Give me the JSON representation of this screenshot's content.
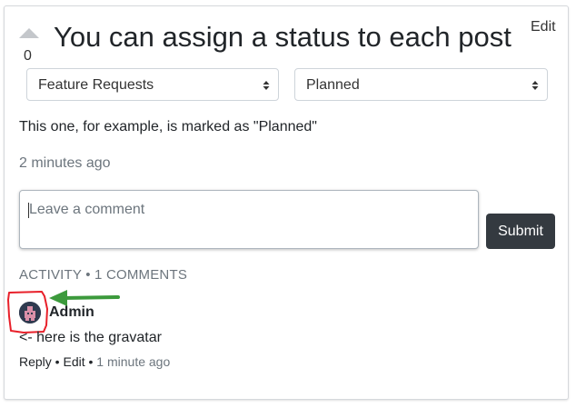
{
  "post": {
    "vote_count": "0",
    "title": "You can assign a status to each post",
    "edit_label": "Edit",
    "category_value": "Feature Requests",
    "status_value": "Planned",
    "body": "This one, for example, is marked as \"Planned\"",
    "timestamp": "2 minutes ago"
  },
  "comment_form": {
    "placeholder": "Leave a comment",
    "submit_label": "Submit"
  },
  "activity": {
    "label": "ACTIVITY",
    "separator": " • ",
    "count_label": "1 COMMENTS"
  },
  "comments": [
    {
      "author": "Admin",
      "text": "<- here is the gravatar",
      "reply_label": "Reply",
      "edit_label": "Edit",
      "separator": " • ",
      "time": "1 minute ago"
    }
  ],
  "colors": {
    "annotation_red": "#e8202a",
    "annotation_green": "#3c9a3c",
    "submit_bg": "#343a40",
    "muted_text": "#6c757d"
  },
  "icons": {
    "upvote": "triangle-up-icon",
    "select_caret": "up-down-caret-icon",
    "avatar": "gravatar-icon",
    "annotation": "green-arrow-icon"
  }
}
